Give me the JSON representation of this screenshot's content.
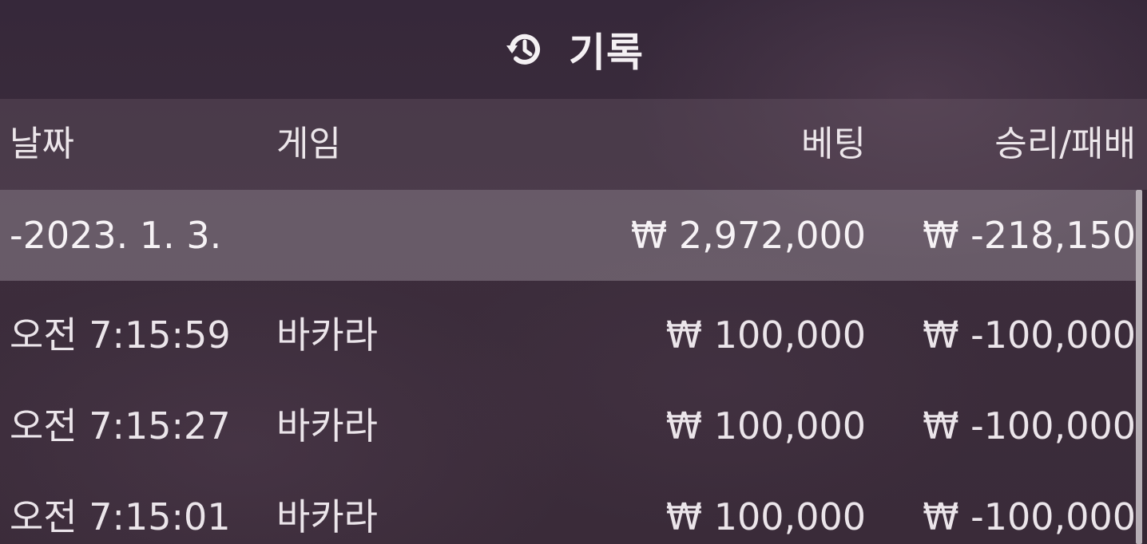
{
  "header": {
    "title": "기록",
    "icon": "history-icon"
  },
  "columns": {
    "date": "날짜",
    "game": "게임",
    "bet": "베팅",
    "result": "승리/패배"
  },
  "day_summary": {
    "date": "-2023. 1. 3.",
    "bet": "₩ 2,972,000",
    "result": "₩ -218,150"
  },
  "rows": [
    {
      "time": "오전 7:15:59",
      "game": "바카라",
      "bet": "₩ 100,000",
      "result": "₩ -100,000"
    },
    {
      "time": "오전 7:15:27",
      "game": "바카라",
      "bet": "₩ 100,000",
      "result": "₩ -100,000"
    },
    {
      "time": "오전 7:15:01",
      "game": "바카라",
      "bet": "₩ 100,000",
      "result": "₩ -100,000"
    }
  ]
}
